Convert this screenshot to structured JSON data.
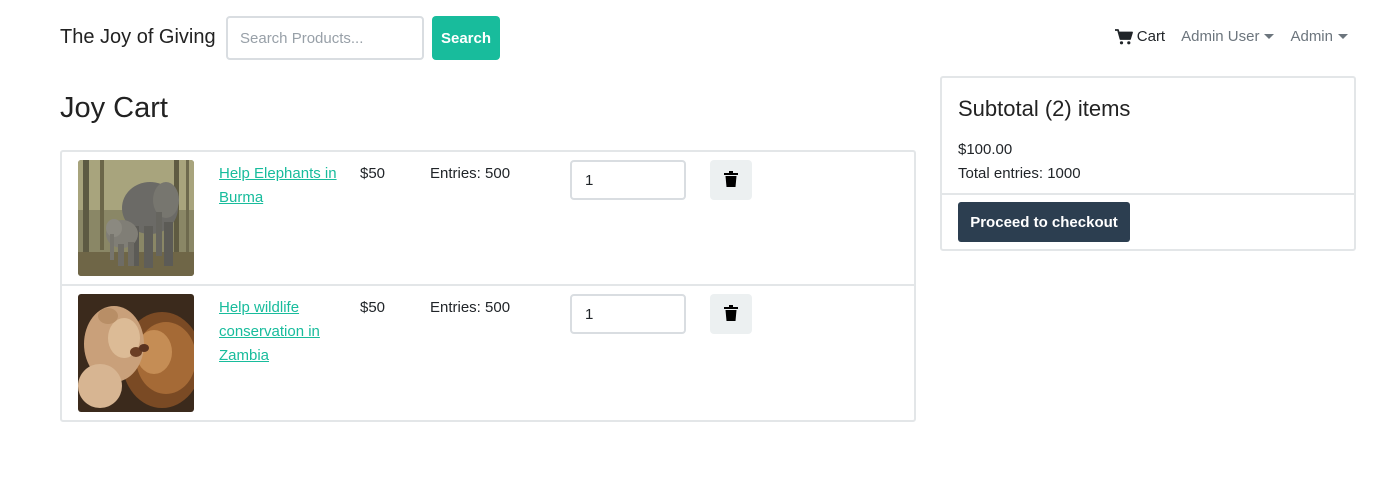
{
  "navbar": {
    "brand": "The Joy of Giving",
    "search_placeholder": "Search Products...",
    "search_button": "Search",
    "cart_label": "Cart",
    "user_menu": "Admin User",
    "admin_menu": "Admin"
  },
  "page": {
    "title": "Joy Cart"
  },
  "cart_items": [
    {
      "name": "Help Elephants in Burma",
      "price": "$50",
      "entries": "Entries: 500",
      "quantity": "1",
      "image": "elephants-photo"
    },
    {
      "name": "Help wildlife conservation in Zambia",
      "price": "$50",
      "entries": "Entries: 500",
      "quantity": "1",
      "image": "lions-photo"
    }
  ],
  "summary": {
    "title": "Subtotal (2) items",
    "total": "$100.00",
    "entries": "Total entries: 1000",
    "checkout_button": "Proceed to checkout"
  },
  "colors": {
    "accent": "#18bc9c",
    "primary_dark": "#2c3e50",
    "light_button": "#ecf0f1",
    "border": "#e3e6e8"
  }
}
